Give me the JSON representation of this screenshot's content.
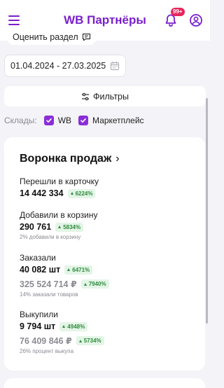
{
  "header": {
    "brand": "WB Партнёры",
    "notifications_badge": "99+",
    "icons": {
      "menu": "hamburger-icon",
      "bell": "bell-icon",
      "user": "user-icon"
    },
    "accent": "#7a1fcc"
  },
  "rate_section": {
    "label": "Оценить раздел",
    "icon": "feedback-icon"
  },
  "date_range": {
    "value": "01.04.2024 - 27.03.2025",
    "icon": "calendar-icon"
  },
  "filters": {
    "label": "Фильтры",
    "icon": "sliders-icon"
  },
  "warehouses": {
    "label": "Склады:",
    "options": [
      {
        "label": "WB",
        "checked": true
      },
      {
        "label": "Маркетплейс",
        "checked": true
      }
    ]
  },
  "funnel": {
    "title": "Воронка продаж",
    "metrics": [
      {
        "label": "Перешли в карточку",
        "value": "14 442 334",
        "change": "6224%"
      },
      {
        "label": "Добавили в корзину",
        "value": "290 761",
        "change": "5834%",
        "note": "2% добавили в корзину"
      },
      {
        "label": "Заказали",
        "value": "40 082 шт",
        "change": "6471%",
        "value2": "325 524 714 ₽",
        "change2": "7940%",
        "note": "14% заказали товаров"
      },
      {
        "label": "Выкупили",
        "value": "9 794 шт",
        "change": "4948%",
        "value2": "76 409 846 ₽",
        "change2": "5734%",
        "note": "26% процент выкупа"
      }
    ]
  }
}
